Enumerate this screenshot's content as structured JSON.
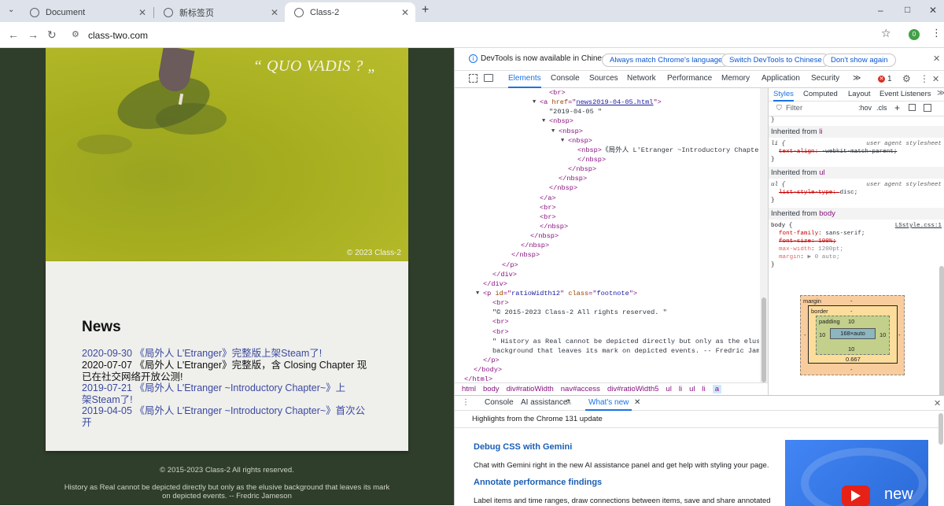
{
  "browser": {
    "tabs": [
      {
        "label": "Document",
        "active": false
      },
      {
        "label": "新标签页",
        "active": false
      },
      {
        "label": "Class-2",
        "active": true
      }
    ],
    "new_tab": "+",
    "url": "class-two.com",
    "profile_initial": "0",
    "window_controls": [
      "–",
      "□",
      "✕"
    ]
  },
  "page": {
    "quote": "“ QUO VADIS ? „",
    "hero_copyright": "© 2023 Class-2",
    "news_title": "News",
    "news_items": [
      {
        "text": "2020-09-30 《局外人 L'Etranger》完整版上架Steam了!",
        "link": true
      },
      {
        "text": "2020-07-07 《局外人 L'Etranger》完整版，含 Closing Chapter 现已在社交网络开放公测!",
        "link": false
      },
      {
        "text": "2019-07-21 《局外人 L'Etranger ~Introductory Chapter~》上架Steam了!",
        "link": true
      },
      {
        "text": "2019-04-05 《局外人 L'Etranger ~Introductory Chapter~》首次公开",
        "link": true
      }
    ],
    "footer_copyright": "© 2015-2023 Class-2 All rights reserved.",
    "footer_quote": "History as Real cannot be depicted directly but only as the elusive background that leaves its mark on depicted events. -- Fredric Jameson"
  },
  "devtools": {
    "infobar": {
      "text": "DevTools is now available in Chinese!",
      "btn_match": "Always match Chrome's language",
      "btn_switch": "Switch DevTools to Chinese",
      "btn_dont": "Don't show again"
    },
    "tabs": [
      "Elements",
      "Console",
      "Sources",
      "Network",
      "Performance",
      "Memory",
      "Application",
      "Security"
    ],
    "more_tabs": "≫",
    "error_count": "1",
    "styles_tabs": [
      "Styles",
      "Computed",
      "Layout",
      "Event Listeners"
    ],
    "filter_placeholder": "Filter",
    "hov": ":hov",
    "cls": ".cls",
    "breadcrumbs": [
      "html",
      "body",
      "div#ratioWidth",
      "nav#access",
      "div#ratioWidth5",
      "ul",
      "li",
      "ul",
      "li",
      "a"
    ],
    "styles": {
      "inherited_li": "Inherited from",
      "li_tag": "li",
      "li_selector": "li {",
      "li_ua": "user agent stylesheet",
      "li_prop": "text-align",
      "li_val": "-webkit-match-parent;",
      "inherited_ul": "Inherited from",
      "ul_tag": "ul",
      "ul_selector": "ul {",
      "ul_ua": "user agent stylesheet",
      "ul_prop": "list-style-type",
      "ul_val": "disc;",
      "inherited_body": "Inherited from",
      "body_tag": "body",
      "body_selector": "body {",
      "body_source": "LSstyle.css:1",
      "body_props": [
        {
          "name": "font-family",
          "value": "sans-serif;",
          "struck": false
        },
        {
          "name": "font-size",
          "value": "100%;",
          "struck": true
        },
        {
          "name": "max-width",
          "value": "1200pt;",
          "struck": false
        },
        {
          "name": "margin",
          "value": "▶ 0 auto;",
          "struck": false
        }
      ],
      "close_brace": "}"
    },
    "box_model": {
      "margin_label": "margin",
      "margin_value": "-",
      "border_label": "border",
      "border_value": "-",
      "padding_label": "padding",
      "padding_value": "10",
      "content": "168×auto",
      "side_left": "10",
      "side_right": "10",
      "bottom_padding": "10",
      "bottom_border": "0.667",
      "outer_left": "-",
      "outer_right": "-",
      "bottom_margin": "-"
    },
    "drawer": {
      "tabs": [
        "Console",
        "AI assistance",
        "What's new"
      ],
      "highlights": "Highlights from the Chrome 131 update",
      "h1": "Debug CSS with Gemini",
      "p1": "Chat with Gemini right in the new AI assistance panel and get help with styling your page.",
      "h2": "Annotate performance findings",
      "p2": "Label items and time ranges, draw connections between items, save and share annotated",
      "thumb_text": "new"
    }
  },
  "dom_tree": [
    {
      "indent": 7,
      "parts": [
        [
          "tg",
          "<br>"
        ]
      ]
    },
    {
      "indent": 6,
      "arrow": "▼",
      "parts": [
        [
          "tg",
          "<a "
        ],
        [
          "an",
          "href"
        ],
        [
          "tg",
          "=\""
        ],
        [
          "av",
          "news2019-04-05.html"
        ],
        [
          "tg",
          "\">"
        ]
      ]
    },
    {
      "indent": 7,
      "parts": [
        [
          "tx",
          "\"2019-04-05 \""
        ]
      ]
    },
    {
      "indent": 7,
      "arrow": "▼",
      "parts": [
        [
          "tg",
          "<nbsp>"
        ]
      ]
    },
    {
      "indent": 8,
      "arrow": "▼",
      "parts": [
        [
          "tg",
          "<nbsp>"
        ]
      ]
    },
    {
      "indent": 9,
      "arrow": "▼",
      "parts": [
        [
          "tg",
          "<nbsp>"
        ]
      ]
    },
    {
      "indent": 10,
      "parts": [
        [
          "tg",
          "<nbsp>"
        ],
        [
          "tx",
          "《局外人 L'Etranger ~Introductory Chapter~》首次公开"
        ]
      ]
    },
    {
      "indent": 10,
      "parts": [
        [
          "tg",
          "</nbsp>"
        ]
      ]
    },
    {
      "indent": 9,
      "parts": [
        [
          "tg",
          "</nbsp>"
        ]
      ]
    },
    {
      "indent": 8,
      "parts": [
        [
          "tg",
          "</nbsp>"
        ]
      ]
    },
    {
      "indent": 7,
      "parts": [
        [
          "tg",
          "</nbsp>"
        ]
      ]
    },
    {
      "indent": 6,
      "parts": [
        [
          "tg",
          "</a>"
        ]
      ]
    },
    {
      "indent": 6,
      "parts": [
        [
          "tg",
          "<br>"
        ]
      ]
    },
    {
      "indent": 6,
      "parts": [
        [
          "tg",
          "<br>"
        ]
      ]
    },
    {
      "indent": 6,
      "parts": [
        [
          "tg",
          "</nbsp>"
        ]
      ]
    },
    {
      "indent": 5,
      "parts": [
        [
          "tg",
          "</nbsp>"
        ]
      ]
    },
    {
      "indent": 4,
      "parts": [
        [
          "tg",
          "</nbsp>"
        ]
      ]
    },
    {
      "indent": 3,
      "parts": [
        [
          "tg",
          "</nbsp>"
        ]
      ]
    },
    {
      "indent": 2,
      "parts": [
        [
          "tg",
          "</p>"
        ]
      ]
    },
    {
      "indent": 1,
      "parts": [
        [
          "tg",
          "</div>"
        ]
      ]
    },
    {
      "indent": 0,
      "parts": [
        [
          "tg",
          "</div>"
        ]
      ]
    },
    {
      "indent": 0,
      "arrow": "▼",
      "parts": [
        [
          "tg",
          "<p "
        ],
        [
          "an",
          "id"
        ],
        [
          "tg",
          "=\""
        ],
        [
          "av",
          "ratioWidth12"
        ],
        [
          "tg",
          "\" "
        ],
        [
          "an",
          "class"
        ],
        [
          "tg",
          "=\""
        ],
        [
          "av",
          "footnote"
        ],
        [
          "tg",
          "\">"
        ]
      ]
    },
    {
      "indent": 1,
      "parts": [
        [
          "tg",
          "<br>"
        ]
      ]
    },
    {
      "indent": 1,
      "parts": [
        [
          "tx",
          "\"© 2015-2023 Class-2 All rights reserved. \""
        ]
      ]
    },
    {
      "indent": 1,
      "parts": [
        [
          "tg",
          "<br>"
        ]
      ]
    },
    {
      "indent": 1,
      "parts": [
        [
          "tg",
          "<br>"
        ]
      ]
    },
    {
      "indent": 1,
      "parts": [
        [
          "tx",
          "\" History as Real cannot be depicted directly but only as the elusive"
        ]
      ]
    },
    {
      "indent": 1,
      "parts": [
        [
          "tx",
          "background that leaves its mark on depicted events. -- Fredric Jameson \""
        ]
      ]
    },
    {
      "indent": 0,
      "parts": [
        [
          "tg",
          "</p>"
        ]
      ]
    },
    {
      "indent": -1,
      "parts": [
        [
          "tg",
          "</body>"
        ]
      ]
    },
    {
      "indent": -2,
      "parts": [
        [
          "tg",
          "</html>"
        ]
      ]
    }
  ]
}
